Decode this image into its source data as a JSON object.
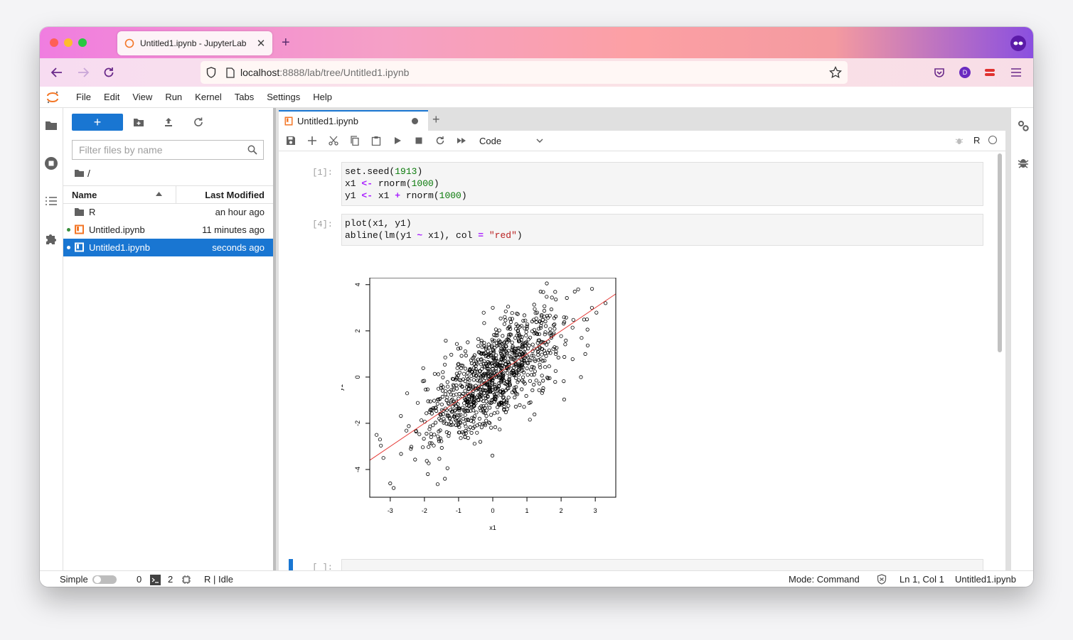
{
  "browser": {
    "tab_title": "Untitled1.ipynb - JupyterLab",
    "tab_close": "✕",
    "new_tab": "+",
    "url_host": "localhost",
    "url_rest": ":8888/lab/tree/Untitled1.ipynb",
    "profile_initial": "D"
  },
  "menu": [
    "File",
    "Edit",
    "View",
    "Run",
    "Kernel",
    "Tabs",
    "Settings",
    "Help"
  ],
  "filebrowser": {
    "new_label": "+",
    "filter_placeholder": "Filter files by name",
    "breadcrumb": "/",
    "col_name": "Name",
    "col_modified": "Last Modified",
    "rows": [
      {
        "name": "R",
        "modified": "an hour ago",
        "type": "folder",
        "running": false
      },
      {
        "name": "Untitled.ipynb",
        "modified": "11 minutes ago",
        "type": "notebook",
        "running": true
      },
      {
        "name": "Untitled1.ipynb",
        "modified": "seconds ago",
        "type": "notebook",
        "running": true,
        "selected": true
      }
    ]
  },
  "notebook": {
    "tab_title": "Untitled1.ipynb",
    "tab_add": "+",
    "cell_type": "Code",
    "kernel_name": "R",
    "cells": [
      {
        "prompt": "[1]:",
        "lines": [
          "set.seed(1913)",
          "x1 <- rnorm(1000)",
          "y1 <- x1 + rnorm(1000)"
        ]
      },
      {
        "prompt": "[4]:",
        "lines": [
          "plot(x1, y1)",
          "abline(lm(y1 ~ x1), col = \"red\")"
        ]
      },
      {
        "prompt": "[ ]:",
        "lines": []
      }
    ]
  },
  "chart_data": {
    "type": "scatter",
    "xlabel": "x1",
    "ylabel": "y1",
    "xlim": [
      -3.6,
      3.6
    ],
    "ylim": [
      -5.2,
      4.3
    ],
    "x_ticks": [
      -3,
      -2,
      -1,
      0,
      1,
      2,
      3
    ],
    "y_ticks": [
      -4,
      -2,
      0,
      2,
      4
    ],
    "n_points": 1000,
    "seed": 1913,
    "series": [
      {
        "name": "points",
        "marker": "open-circle",
        "color": "#000000",
        "sample_points": [
          [
            -2.9,
            -4.8
          ],
          [
            -3.0,
            -4.6
          ],
          [
            -3.3,
            -2.7
          ],
          [
            -3.4,
            -2.5
          ],
          [
            -3.2,
            -3.5
          ],
          [
            2.5,
            3.8
          ],
          [
            2.4,
            3.7
          ],
          [
            1.4,
            3.7
          ],
          [
            3.3,
            3.2
          ],
          [
            2.9,
            3.0
          ],
          [
            -1.4,
            -4.4
          ],
          [
            -1.9,
            -4.2
          ],
          [
            0.0,
            3.0
          ]
        ]
      }
    ],
    "regression_line": {
      "color": "#e53935",
      "intercept": 0.0,
      "slope": 1.0
    }
  },
  "statusbar": {
    "mode_label": "Simple",
    "terminals": "0",
    "kernels": "2",
    "kernel_state": "R | Idle",
    "mode": "Mode: Command",
    "cursor": "Ln 1, Col 1",
    "file": "Untitled1.ipynb"
  },
  "colors": {
    "accent": "#1976d2",
    "regression": "#e53935",
    "notebook_orange": "#f37626"
  }
}
